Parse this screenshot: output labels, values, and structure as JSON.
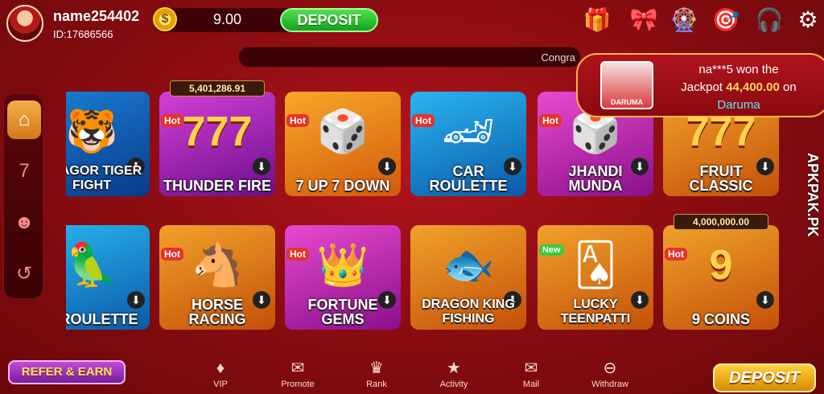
{
  "user": {
    "name": "name254402",
    "id_label": "ID:17686566"
  },
  "wallet": {
    "balance": "9.00",
    "deposit_label": "DEPOSIT"
  },
  "top_icons": [
    "gift-box-icon",
    "present-icon",
    "lucky-wheel-icon",
    "promo-icon",
    "support-icon",
    "settings-icon"
  ],
  "marquee": {
    "text": "Congra"
  },
  "jackpot_toast": {
    "player": "na***5 won the",
    "prefix": "Jackpot",
    "amount": "44,400.00",
    "suffix": "on",
    "game": "Daruma",
    "image_label": "DARUMA"
  },
  "side_nav": [
    {
      "name": "home",
      "glyph": "⌂"
    },
    {
      "name": "slots",
      "glyph": "7"
    },
    {
      "name": "players",
      "glyph": "☻"
    },
    {
      "name": "history",
      "glyph": "↺"
    }
  ],
  "games": [
    {
      "title": "BAAGOR TIGER  FIGHT",
      "colors": [
        "#1a7fd4",
        "#0a3a8a"
      ],
      "glyph": "🐯"
    },
    {
      "title": "THUNDER FIRE",
      "colors": [
        "#d43fd8",
        "#6a0f8a"
      ],
      "glyph": "777",
      "badge": "Hot",
      "jackpot": "5,401,286.91"
    },
    {
      "title": "7 UP 7 DOWN",
      "colors": [
        "#f7a82a",
        "#d45a0a"
      ],
      "glyph": "🎲",
      "badge": "Hot"
    },
    {
      "title": "CAR ROULETTE",
      "colors": [
        "#2ab5f0",
        "#0a5aa8"
      ],
      "glyph": "🏎",
      "badge": "Hot"
    },
    {
      "title": "JHANDI MUNDA",
      "colors": [
        "#e84ad0",
        "#8a0f8a"
      ],
      "glyph": "🎲",
      "badge": "Hot"
    },
    {
      "title": "FRUIT CLASSIC",
      "colors": [
        "#f0a22a",
        "#c4500a"
      ],
      "glyph": "777"
    },
    {
      "title": "D ROULETTE",
      "colors": [
        "#2ab5f0",
        "#0a5aa8"
      ],
      "glyph": "🦜"
    },
    {
      "title": "HORSE RACING",
      "colors": [
        "#f0a22a",
        "#c4500a"
      ],
      "glyph": "🐴",
      "badge": "Hot"
    },
    {
      "title": "FORTUNE GEMS",
      "colors": [
        "#e84ad0",
        "#8a0f8a"
      ],
      "glyph": "👑",
      "badge": "Hot"
    },
    {
      "title": "DRAGON KING FISHING",
      "colors": [
        "#f0a22a",
        "#c4500a"
      ],
      "glyph": "🐟"
    },
    {
      "title": "LUCKY TEENPATTI",
      "colors": [
        "#f0a22a",
        "#c4500a"
      ],
      "glyph": "🂡",
      "badge": "New"
    },
    {
      "title": "9 COINS",
      "colors": [
        "#f0a22a",
        "#c4500a"
      ],
      "glyph": "9",
      "badge": "Hot",
      "jackpot": "4,000,000.00"
    }
  ],
  "watermark": "APKPAK.PK",
  "bottom_nav": {
    "refer": "REFER & EARN",
    "items": [
      {
        "label": "VIP",
        "glyph": "♦"
      },
      {
        "label": "Promote",
        "glyph": "✉"
      },
      {
        "label": "Rank",
        "glyph": "♛"
      },
      {
        "label": "Activity",
        "glyph": "★"
      },
      {
        "label": "Mail",
        "glyph": "✉"
      },
      {
        "label": "Withdraw",
        "glyph": "⊖"
      }
    ],
    "deposit": "DEPOSIT"
  }
}
